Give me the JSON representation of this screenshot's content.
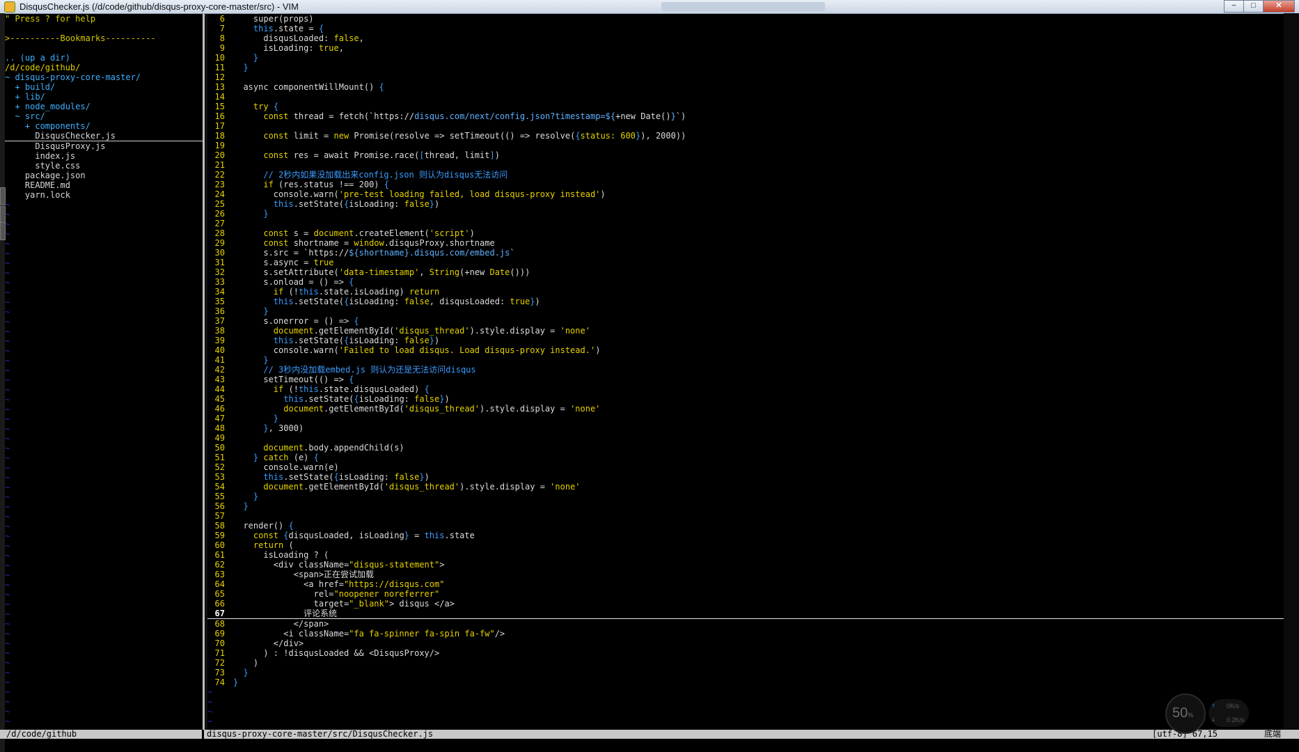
{
  "window": {
    "title": "DisqusChecker.js (/d/code/github/disqus-proxy-core-master/src) - VIM",
    "min_label": "−",
    "max_label": "□",
    "close_label": "✕"
  },
  "tree": {
    "lines": [
      {
        "text": "\" Press ? for help",
        "cls": "help"
      },
      {
        "text": "",
        "cls": ""
      },
      {
        "text": ">----------Bookmarks----------",
        "cls": "bm"
      },
      {
        "text": "",
        "cls": ""
      },
      {
        "text": ".. (up a dir)",
        "cls": "dir"
      },
      {
        "text": "/d/code/github/",
        "cls": "root"
      },
      {
        "text": "~ disqus-proxy-core-master/",
        "cls": "dir"
      },
      {
        "text": "  + build/",
        "cls": "dir"
      },
      {
        "text": "  + lib/",
        "cls": "dir"
      },
      {
        "text": "  + node_modules/",
        "cls": "dir"
      },
      {
        "text": "  ~ src/",
        "cls": "dir"
      },
      {
        "text": "    + components/",
        "cls": "dir"
      },
      {
        "text": "      DisqusChecker.js",
        "cls": "sel"
      },
      {
        "text": "      DisqusProxy.js",
        "cls": ""
      },
      {
        "text": "      index.js",
        "cls": ""
      },
      {
        "text": "      style.css",
        "cls": ""
      },
      {
        "text": "    package.json",
        "cls": ""
      },
      {
        "text": "    README.md",
        "cls": ""
      },
      {
        "text": "    yarn.lock",
        "cls": ""
      }
    ]
  },
  "editor": {
    "current_line": 67,
    "lines": [
      {
        "n": "6",
        "h": "    super(props)"
      },
      {
        "n": "7",
        "h": "    <span class='kw'>this</span>.state = <span class='br'>{</span>"
      },
      {
        "n": "8",
        "h": "      disqusLoaded: <span class='s'>false</span>,"
      },
      {
        "n": "9",
        "h": "      isLoading: <span class='s'>true</span>,"
      },
      {
        "n": "10",
        "h": "    <span class='br'>}</span>"
      },
      {
        "n": "11",
        "h": "  <span class='br'>}</span>"
      },
      {
        "n": "12",
        "h": ""
      },
      {
        "n": "13",
        "h": "  async componentWillMount() <span class='br'>{</span>"
      },
      {
        "n": "14",
        "h": ""
      },
      {
        "n": "15",
        "h": "    <span class='k'>try</span> <span class='br'>{</span>"
      },
      {
        "n": "16",
        "h": "      <span class='k'>const</span> thread = fetch(`https://<span class='st2'>disqus.com/next/config.json?timestamp=${</span>+new Date()<span class='st2'>}</span>`)"
      },
      {
        "n": "17",
        "h": ""
      },
      {
        "n": "18",
        "h": "      <span class='k'>const</span> limit = <span class='k'>new</span> Promise(resolve =&gt; setTimeout(() =&gt; resolve(<span class='br'>{</span><span class='s'>status: 600</span><span class='br'>}</span>), 2000))"
      },
      {
        "n": "19",
        "h": ""
      },
      {
        "n": "20",
        "h": "      <span class='k'>const</span> res = await Promise.race(<span class='br'>[</span>thread, limit<span class='br'>]</span>)"
      },
      {
        "n": "21",
        "h": ""
      },
      {
        "n": "22",
        "h": "      <span class='c'>// 2秒内如果没加载出来config.json 则认为disqus无法访问</span>"
      },
      {
        "n": "23",
        "h": "      <span class='k'>if</span> (res.status !== 200) <span class='br'>{</span>"
      },
      {
        "n": "24",
        "h": "        console.warn(<span class='str'>'pre-test loading failed, load disqus-proxy instead'</span>)"
      },
      {
        "n": "25",
        "h": "        <span class='kw'>this</span>.setState(<span class='br'>{</span>isLoading: <span class='s'>false</span><span class='br'>}</span>)"
      },
      {
        "n": "26",
        "h": "      <span class='br'>}</span>"
      },
      {
        "n": "27",
        "h": ""
      },
      {
        "n": "28",
        "h": "      <span class='k'>const</span> s = <span class='s'>document</span>.createElement(<span class='str'>'script'</span>)"
      },
      {
        "n": "29",
        "h": "      <span class='k'>const</span> shortname = <span class='s'>window</span>.disqusProxy.shortname"
      },
      {
        "n": "30",
        "h": "      s.src = `https://<span class='st2'>${shortname}.disqus.com/embed.js</span>`"
      },
      {
        "n": "31",
        "h": "      s.async = <span class='s'>true</span>"
      },
      {
        "n": "32",
        "h": "      s.setAttribute(<span class='str'>'data-timestamp'</span>, <span class='s'>String</span>(+new <span class='s'>Date</span>()))"
      },
      {
        "n": "33",
        "h": "      s.onload = () =&gt; <span class='br'>{</span>"
      },
      {
        "n": "34",
        "h": "        <span class='k'>if</span> (!<span class='kw'>this</span>.state.isLoading) <span class='k'>return</span>"
      },
      {
        "n": "35",
        "h": "        <span class='kw'>this</span>.setState(<span class='br'>{</span>isLoading: <span class='s'>false</span>, disqusLoaded: <span class='s'>true</span><span class='br'>}</span>)"
      },
      {
        "n": "36",
        "h": "      <span class='br'>}</span>"
      },
      {
        "n": "37",
        "h": "      s.onerror = () =&gt; <span class='br'>{</span>"
      },
      {
        "n": "38",
        "h": "        <span class='s'>document</span>.getElementById(<span class='str'>'disqus_thread'</span>).style.display = <span class='str'>'none'</span>"
      },
      {
        "n": "39",
        "h": "        <span class='kw'>this</span>.setState(<span class='br'>{</span>isLoading: <span class='s'>false</span><span class='br'>}</span>)"
      },
      {
        "n": "40",
        "h": "        console.warn(<span class='str'>'Failed to load disqus. Load disqus-proxy instead.'</span>)"
      },
      {
        "n": "41",
        "h": "      <span class='br'>}</span>"
      },
      {
        "n": "42",
        "h": "      <span class='c'>// 3秒内没加载embed.js 则认为还是无法访问disqus</span>"
      },
      {
        "n": "43",
        "h": "      setTimeout(() =&gt; <span class='br'>{</span>"
      },
      {
        "n": "44",
        "h": "        <span class='k'>if</span> (!<span class='kw'>this</span>.state.disqusLoaded) <span class='br'>{</span>"
      },
      {
        "n": "45",
        "h": "          <span class='kw'>this</span>.setState(<span class='br'>{</span>isLoading: <span class='s'>false</span><span class='br'>}</span>)"
      },
      {
        "n": "46",
        "h": "          <span class='s'>document</span>.getElementById(<span class='str'>'disqus_thread'</span>).style.display = <span class='str'>'none'</span>"
      },
      {
        "n": "47",
        "h": "        <span class='br'>}</span>"
      },
      {
        "n": "48",
        "h": "      <span class='br'>}</span>, 3000)"
      },
      {
        "n": "49",
        "h": ""
      },
      {
        "n": "50",
        "h": "      <span class='s'>document</span>.body.appendChild(s)"
      },
      {
        "n": "51",
        "h": "    <span class='br'>}</span> <span class='k'>catch</span> (e) <span class='br'>{</span>"
      },
      {
        "n": "52",
        "h": "      console.warn(e)"
      },
      {
        "n": "53",
        "h": "      <span class='kw'>this</span>.setState(<span class='br'>{</span>isLoading: <span class='s'>false</span><span class='br'>}</span>)"
      },
      {
        "n": "54",
        "h": "      <span class='s'>document</span>.getElementById(<span class='str'>'disqus_thread'</span>).style.display = <span class='str'>'none'</span>"
      },
      {
        "n": "55",
        "h": "    <span class='br'>}</span>"
      },
      {
        "n": "56",
        "h": "  <span class='br'>}</span>"
      },
      {
        "n": "57",
        "h": ""
      },
      {
        "n": "58",
        "h": "  render() <span class='br'>{</span>"
      },
      {
        "n": "59",
        "h": "    <span class='k'>const</span> <span class='br'>{</span>disqusLoaded, isLoading<span class='br'>}</span> = <span class='kw'>this</span>.state"
      },
      {
        "n": "60",
        "h": "    <span class='k'>return</span> ("
      },
      {
        "n": "61",
        "h": "      isLoading ? ("
      },
      {
        "n": "62",
        "h": "        &lt;div className=<span class='str'>\"disqus-statement\"</span>&gt;"
      },
      {
        "n": "63",
        "h": "            &lt;span&gt;正在尝试加载"
      },
      {
        "n": "64",
        "h": "              &lt;a href=<span class='str'>\"https://disqus.com\"</span>"
      },
      {
        "n": "65",
        "h": "                rel=<span class='str'>\"noopener noreferrer\"</span>"
      },
      {
        "n": "66",
        "h": "                target=<span class='str'>\"_blank\"</span>&gt; disqus &lt;/a&gt;"
      },
      {
        "n": "67",
        "h": "              评论系统"
      },
      {
        "n": "68",
        "h": "            &lt;/span&gt;"
      },
      {
        "n": "69",
        "h": "          &lt;i className=<span class='str'>\"fa fa-spinner fa-spin fa-fw\"</span>/&gt;"
      },
      {
        "n": "70",
        "h": "        &lt;/div&gt;"
      },
      {
        "n": "71",
        "h": "      ) : !disqusLoaded &amp;&amp; &lt;DisqusProxy/&gt;"
      },
      {
        "n": "72",
        "h": "    )"
      },
      {
        "n": "73",
        "h": "  <span class='br'>}</span>"
      },
      {
        "n": "74",
        "h": "<span class='br'>}</span>"
      }
    ]
  },
  "status": {
    "left": "/d/code/github",
    "middle": "disqus-proxy-core-master/src/DisqusChecker.js",
    "right": "[utf-8] 67,15",
    "far_right": "底端"
  },
  "widget": {
    "cpu": "50",
    "cpu_unit": "%",
    "up": "0K/s",
    "down": "0.2K/s"
  }
}
